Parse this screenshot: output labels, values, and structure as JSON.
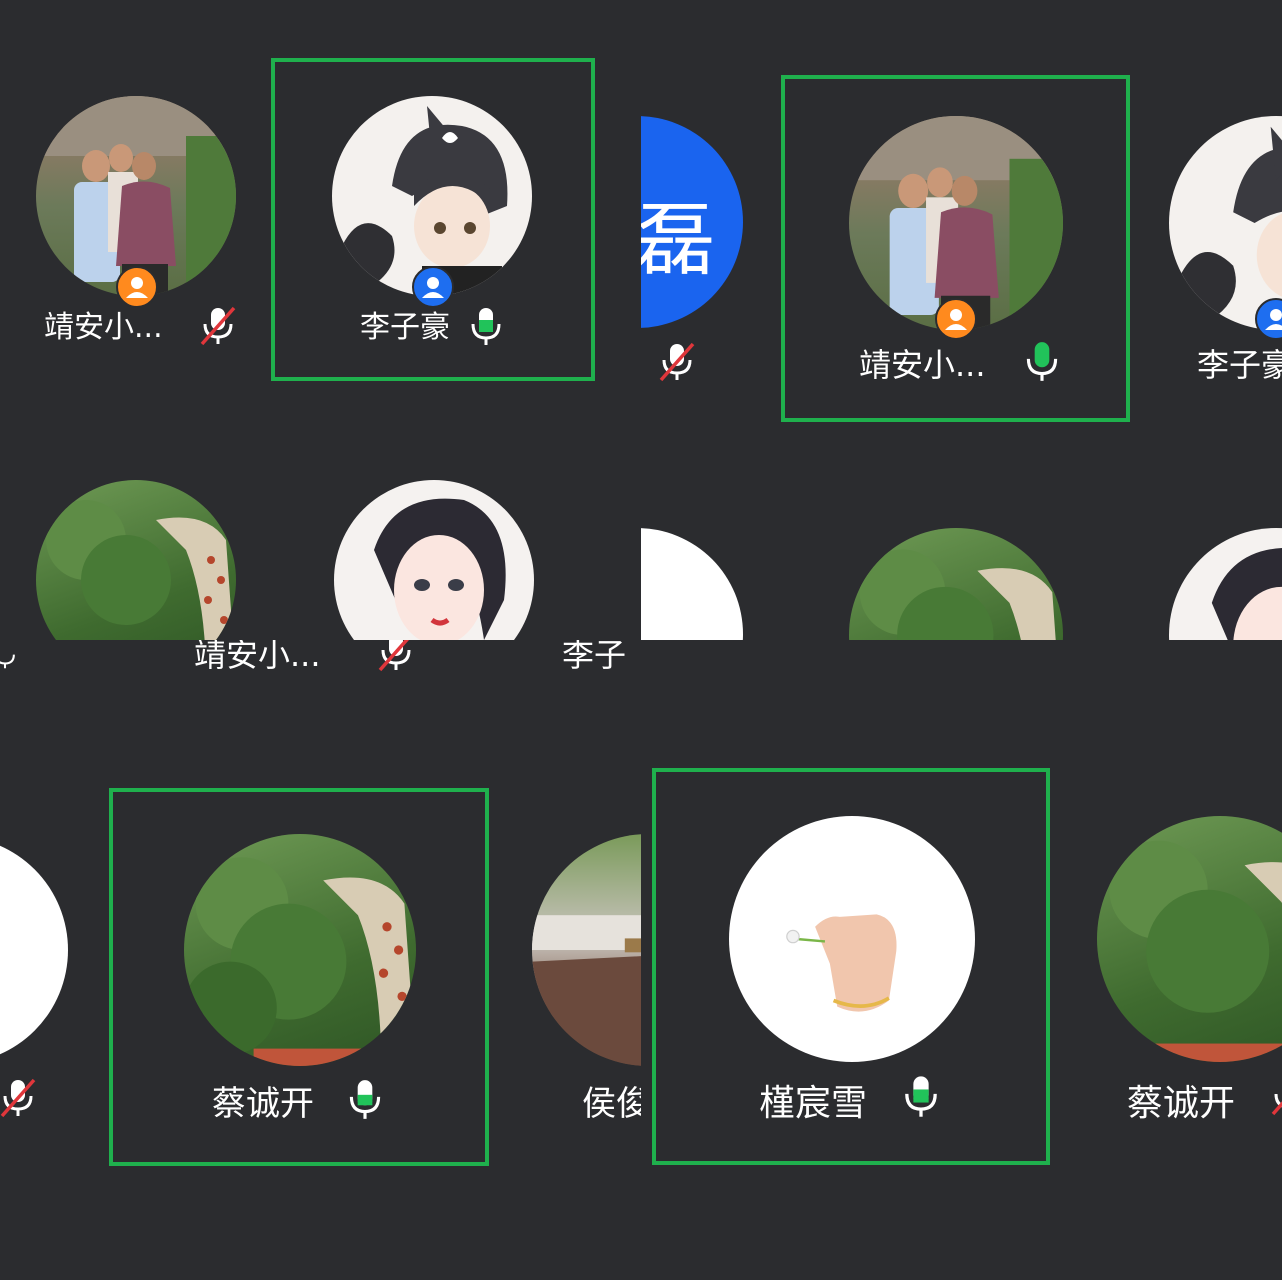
{
  "participants": {
    "jingan": "靖安小...",
    "lizihao": "李子豪",
    "lizi_cut": "李子",
    "lizihao_cut": "李子豪",
    "caichengkai": "蔡诚开",
    "jinchenxue": "槿宸雪",
    "hou_cut": "侯俊",
    "lei_char": "磊"
  },
  "colors": {
    "background": "#2b2c2f",
    "speaking_border": "#1fb04d",
    "mic_active": "#21c35a",
    "mic_muted_slash": "#e0363b",
    "host_badge": "#ff8a1e",
    "cohost_badge": "#1e6ef0",
    "avatar_blue": "#1a64ef"
  },
  "icons": {
    "mic_on": "microphone-active-icon",
    "mic_off": "microphone-muted-icon",
    "host": "person-badge-icon"
  }
}
